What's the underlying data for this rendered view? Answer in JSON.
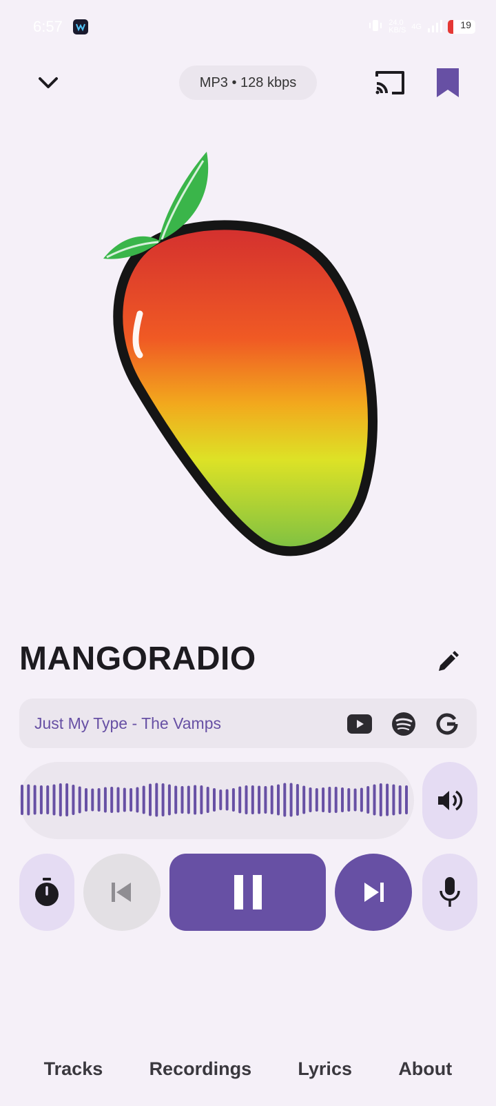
{
  "status_bar": {
    "time": "6:57",
    "net_speed": "24.0\nKB/S",
    "signal_label": "4G",
    "battery": "19"
  },
  "header": {
    "format_chip": "MP3 • 128 kbps"
  },
  "station": {
    "title": "MANGORADIO"
  },
  "now_playing": {
    "track": "Just My Type - The Vamps",
    "services": [
      "youtube-icon",
      "spotify-icon",
      "google-icon"
    ]
  },
  "controls": {
    "timer": "timer-icon",
    "previous": "skip-previous-icon",
    "pause": "pause-icon",
    "next": "skip-next-icon",
    "mic": "mic-icon",
    "volume": "volume-icon"
  },
  "bottom_nav": {
    "tabs": [
      "Tracks",
      "Recordings",
      "Lyrics",
      "About"
    ]
  },
  "colors": {
    "accent": "#6750a4",
    "accent_container": "#e5dcf3",
    "surface": "#f5f0f8",
    "surface_variant": "#ebe6ee",
    "disabled_button": "#e3e0e4"
  }
}
